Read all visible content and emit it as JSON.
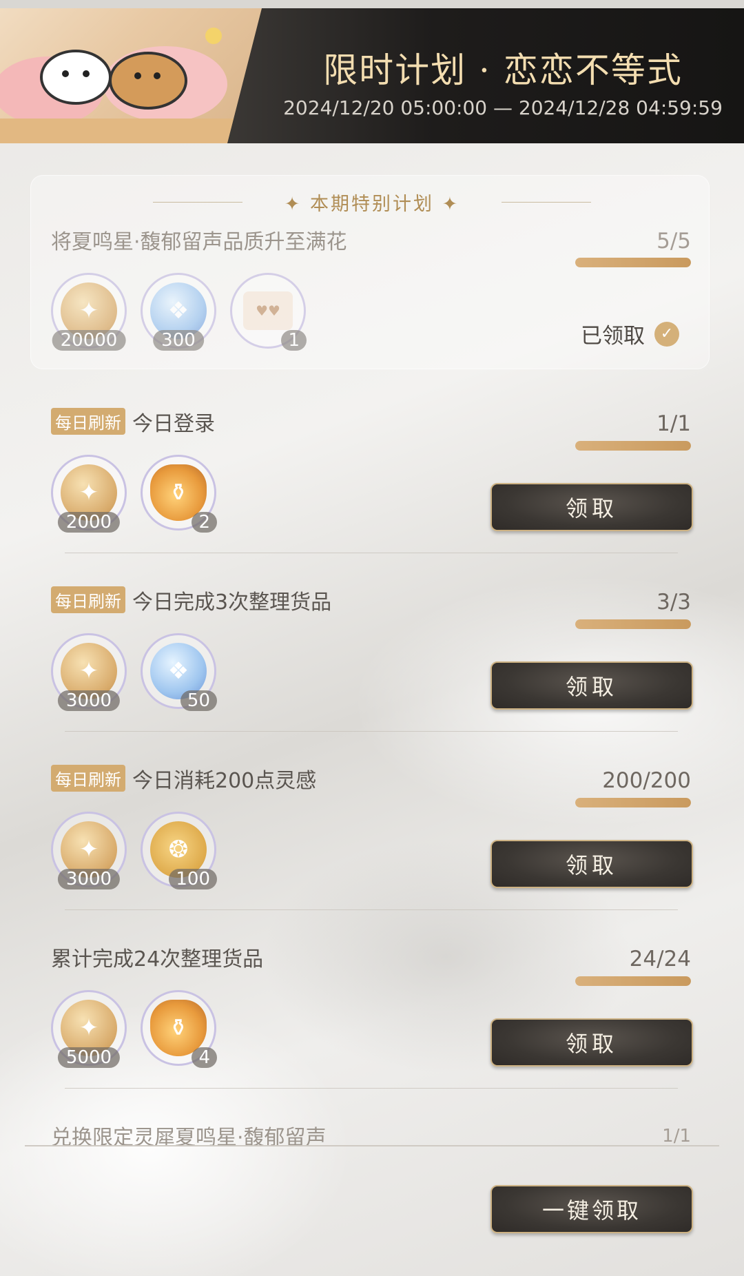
{
  "banner": {
    "title": "限时计划 · 恋恋不等式",
    "date_range": "2024/12/20 05:00:00 — 2024/12/28 04:59:59"
  },
  "special": {
    "header": "✦  本期特别计划  ✦",
    "title": "将夏鸣星·馥郁留声品质升至满花",
    "progress_text": "5/5",
    "progress": 1.0,
    "rewards": [
      "20000",
      "300",
      "1"
    ],
    "claimed_label": "已领取",
    "check_icon": "✓"
  },
  "tag_label": "每日刷新",
  "claim_label": "领取",
  "tasks": [
    {
      "title": "今日登录",
      "progress_text": "1/1",
      "progress": 1.0,
      "rewards": [
        "2000",
        "2"
      ]
    },
    {
      "title": "今日完成3次整理货品",
      "progress_text": "3/3",
      "progress": 1.0,
      "rewards": [
        "3000",
        "50"
      ]
    },
    {
      "title": "今日消耗200点灵感",
      "progress_text": "200/200",
      "progress": 1.0,
      "rewards": [
        "3000",
        "100"
      ]
    },
    {
      "title": "累计完成24次整理货品",
      "progress_text": "24/24",
      "progress": 1.0,
      "rewards": [
        "5000",
        "4"
      ]
    }
  ],
  "last_task": {
    "title": "兑换限定灵犀夏鸣星·馥郁留声",
    "progress_text": "1/1"
  },
  "claim_all_label": "一键领取",
  "colors": {
    "accent_gold": "#d3ab70",
    "button_dark": "#3b3733",
    "banner_title": "#f3ddb0"
  }
}
